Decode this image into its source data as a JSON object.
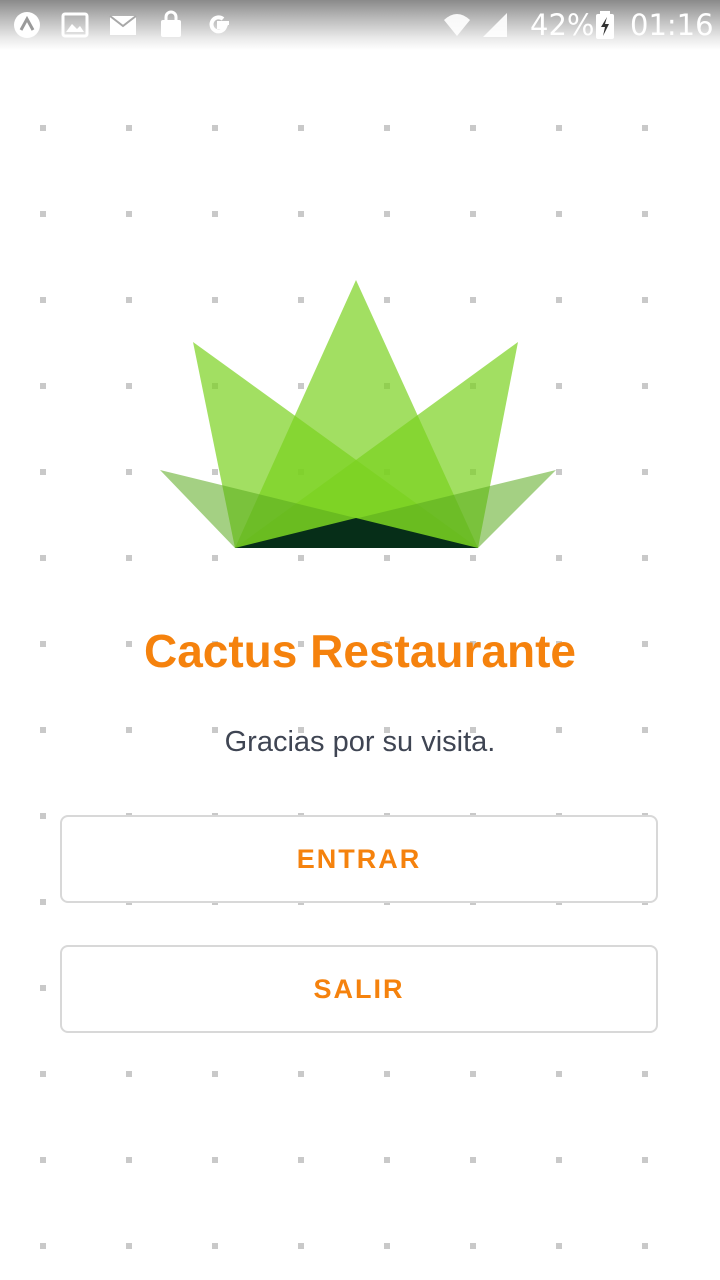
{
  "status_bar": {
    "battery": "42%",
    "time": "01:16",
    "icons": [
      "app-notification-icon",
      "image-icon",
      "mail-icon",
      "shopping-bag-icon",
      "google-icon",
      "wifi-icon",
      "signal-icon",
      "battery-charging-icon"
    ]
  },
  "app": {
    "title": "Cactus Restaurante",
    "subtitle": "Gracias por su visita.",
    "logo_icon": "cactus-crown-logo",
    "accent_color": "#f5820d",
    "text_color": "#3f4553"
  },
  "buttons": {
    "enter_label": "ENTRAR",
    "exit_label": "SALIR"
  }
}
